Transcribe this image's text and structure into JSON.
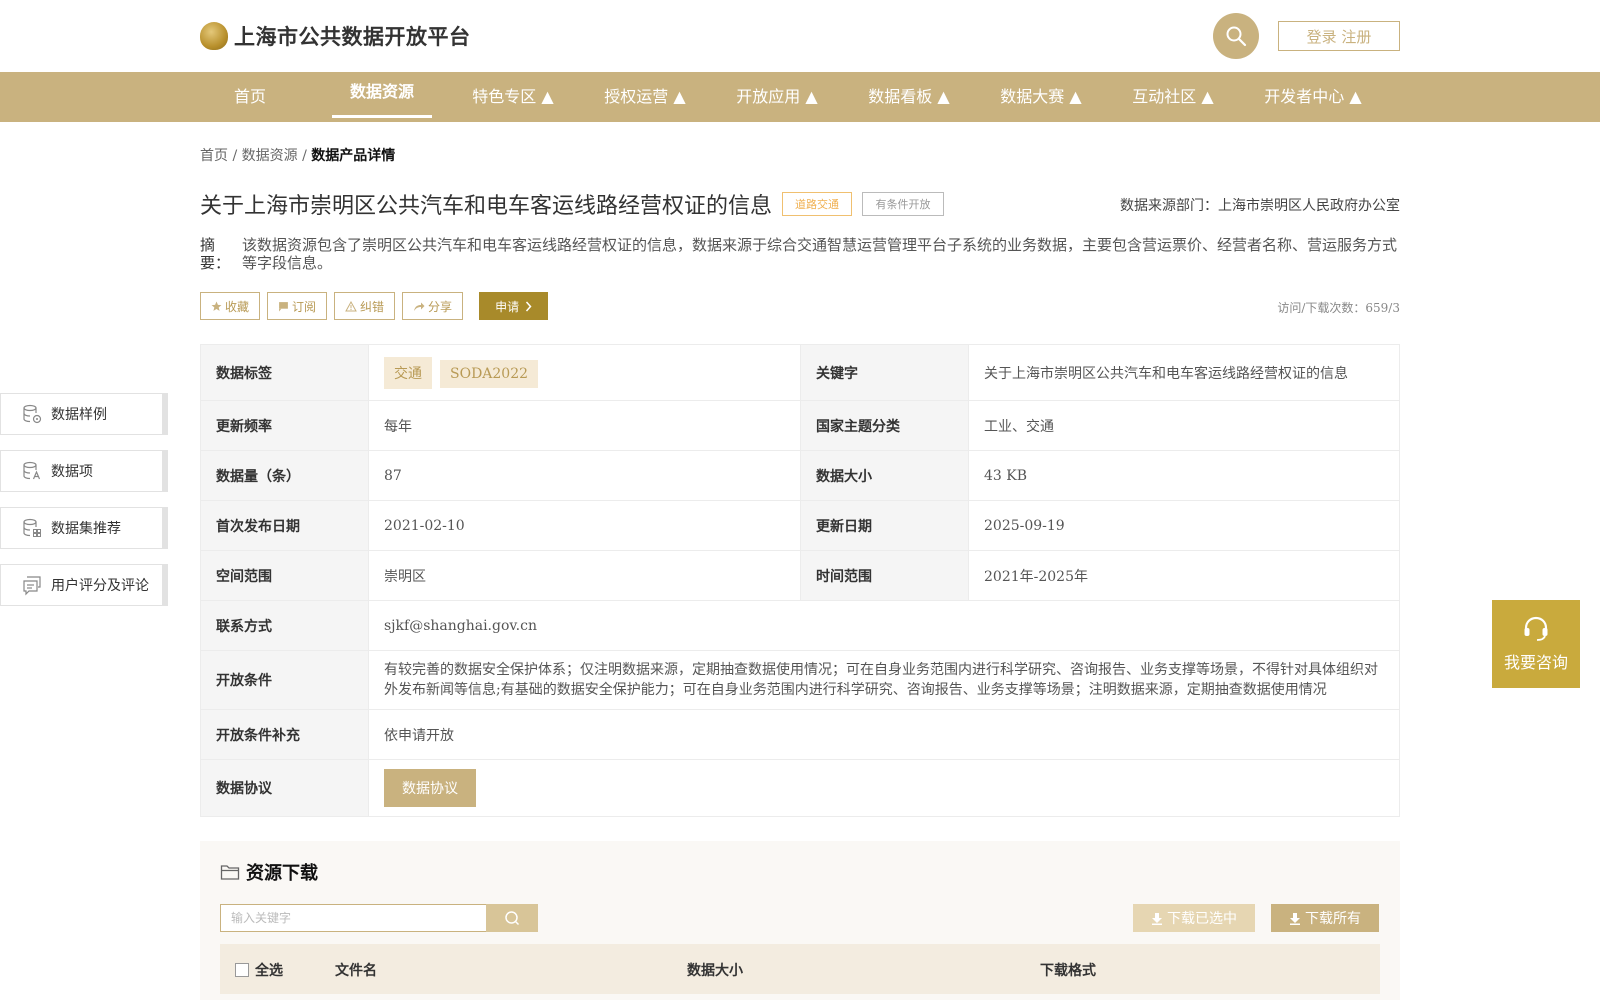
{
  "header": {
    "site_title": "上海市公共数据开放平台",
    "login_label": "登录 注册"
  },
  "nav": [
    {
      "label": "首页"
    },
    {
      "label": "数据资源"
    },
    {
      "label": "特色专区 ▲"
    },
    {
      "label": "授权运营 ▲"
    },
    {
      "label": "开放应用 ▲"
    },
    {
      "label": "数据看板 ▲"
    },
    {
      "label": "数据大赛 ▲"
    },
    {
      "label": "互动社区 ▲"
    },
    {
      "label": "开发者中心 ▲"
    }
  ],
  "breadcrumb": {
    "home": "首页",
    "sep": " / ",
    "section": "数据资源",
    "current": "数据产品详情"
  },
  "dataset": {
    "title": "关于上海市崇明区公共汽车和电车客运线路经营权证的信息",
    "tag_category": "道路交通",
    "tag_open": "有条件开放",
    "source": "数据来源部门：上海市崇明区人民政府办公室",
    "abstract_label": "摘　要：",
    "abstract": "该数据资源包含了崇明区公共汽车和电车客运线路经营权证的信息，数据来源于综合交通智慧运营管理平台子系统的业务数据，主要包含营运票价、经营者名称、营运服务方式等字段信息。",
    "visits": "访问/下载次数：659/3"
  },
  "actions": {
    "favorite": "收藏",
    "subscribe": "订阅",
    "report": "纠错",
    "share": "分享",
    "apply": "申请"
  },
  "info": {
    "tags_label": "数据标签",
    "tags": [
      "交通",
      "SODA2022"
    ],
    "keyword_label": "关键字",
    "keyword": "关于上海市崇明区公共汽车和电车客运线路经营权证的信息",
    "freq_label": "更新频率",
    "freq": "每年",
    "theme_label": "国家主题分类",
    "theme": "工业、交通",
    "count_label": "数据量（条）",
    "count": "87",
    "size_label": "数据大小",
    "size": "43 KB",
    "first_label": "首次发布日期",
    "first": "2021-02-10",
    "update_label": "更新日期",
    "update": "2025-09-19",
    "space_label": "空间范围",
    "space": "崇明区",
    "time_label": "时间范围",
    "time": "2021年-2025年",
    "contact_label": "联系方式",
    "contact": "sjkf@shanghai.gov.cn",
    "cond_label": "开放条件",
    "cond": "有较完善的数据安全保护体系；仅注明数据来源，定期抽查数据使用情况；可在自身业务范围内进行科学研究、咨询报告、业务支撑等场景，不得针对具体组织对外发布新闻等信息;有基础的数据安全保护能力；可在自身业务范围内进行科学研究、咨询报告、业务支撑等场景；注明数据来源，定期抽查数据使用情况",
    "cond_extra_label": "开放条件补充",
    "cond_extra": "依申请开放",
    "protocol_label": "数据协议",
    "protocol_btn": "数据协议"
  },
  "sidebar": [
    {
      "label": "数据样例"
    },
    {
      "label": "数据项"
    },
    {
      "label": "数据集推荐"
    },
    {
      "label": "用户评分及评论"
    }
  ],
  "consult": {
    "label": "我要咨询"
  },
  "download": {
    "title": "资源下载",
    "search_placeholder": "输入关键字",
    "download_selected": "下载已选中",
    "download_all": "下载所有",
    "col_select_all": "全选",
    "col_filename": "文件名",
    "col_size": "数据大小",
    "col_format": "下载格式"
  }
}
